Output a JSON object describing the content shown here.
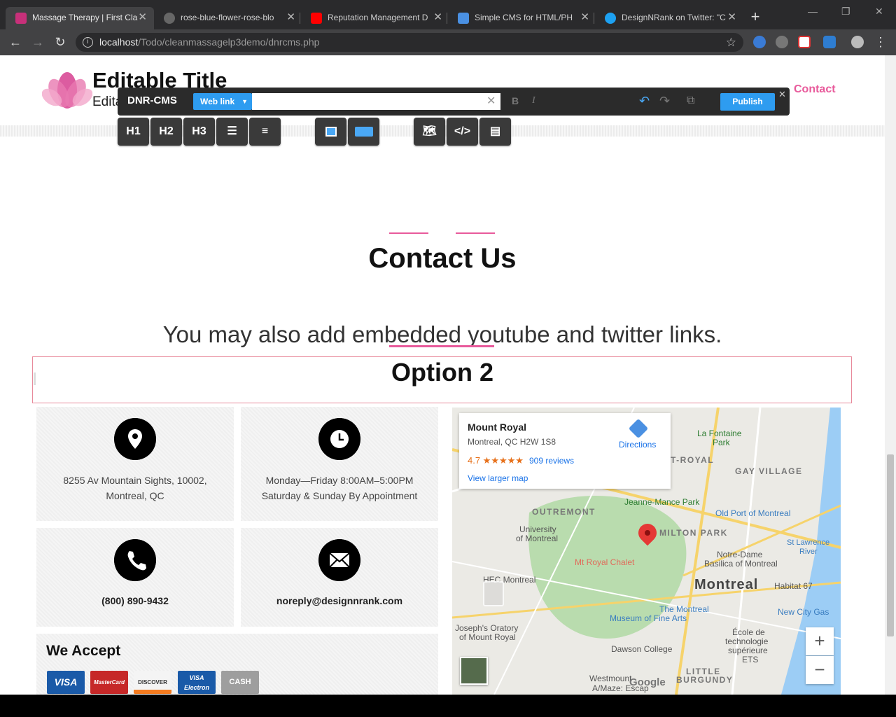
{
  "browser": {
    "tabs": [
      {
        "title": "Massage Therapy | First Cla",
        "color": "#c8307a"
      },
      {
        "title": "rose-blue-flower-rose-blo",
        "color": "#666666"
      },
      {
        "title": "Reputation Management D",
        "color": "#ff0000"
      },
      {
        "title": "Simple CMS for HTML/PH",
        "color": "#4a90e2"
      },
      {
        "title": "DesignNRank on Twitter: \"C",
        "color": "#1da1f2"
      }
    ],
    "url_host": "localhost",
    "url_path": "/Todo/cleanmassagelp3demo/dnrcms.php"
  },
  "site": {
    "title": "Editable Title",
    "subtitle": "Edita",
    "nav_contact": "Contact",
    "accent": "#e85a9b"
  },
  "cms": {
    "brand": "DNR-CMS",
    "link_type": "Web link",
    "link_value": "",
    "bold": "B",
    "italic": "I",
    "publish": "Publish",
    "tools": [
      "H1",
      "H2",
      "H3"
    ]
  },
  "content": {
    "heading": "Contact Us",
    "lead": "You may also add embedded youtube and twitter links.",
    "option_title": "Option 2"
  },
  "contact": {
    "address_line1": "8255 Av Mountain Sights, 10002,",
    "address_line2": "Montreal, QC",
    "hours_line1": "Monday—Friday 8:00AM–5:00PM",
    "hours_line2": "Saturday & Sunday By Appointment",
    "phone": "(800) 890-9432",
    "email": "noreply@designnrank.com",
    "accept_title": "We Accept",
    "payments": [
      {
        "label": "VISA",
        "color": "#1a5aa8"
      },
      {
        "label": "MasterCard",
        "color": "#c62828"
      },
      {
        "label": "DISCOVER",
        "color": "#f4f4f4"
      },
      {
        "label": "VISA Electron",
        "color": "#1a5aa8"
      },
      {
        "label": "CASH",
        "color": "#9e9e9e"
      }
    ]
  },
  "map": {
    "place": "Mount Royal",
    "address": "Montreal, QC H2W 1S8",
    "rating": "4.7 ★★★★★",
    "reviews": "909 reviews",
    "larger": "View larger map",
    "directions": "Directions",
    "labels": {
      "city": "Montreal",
      "milton": "MILTON PARK",
      "outremont": "OUTREMONT",
      "gay_village": "GAY VILLAGE",
      "royal": "T-ROYAL",
      "lafontaine": "La Fontaine",
      "lafontaine2": "Park",
      "jeanne": "Jeanne-Mance Park",
      "oldport": "Old Port of Montreal",
      "university": "University",
      "university2": "of Montreal",
      "chalet": "Mt Royal Chalet",
      "notre": "Notre-Dame",
      "basilica": "Basilica of Montreal",
      "hec": "HEC Montreal",
      "habitat": "Habitat 67",
      "museum1": "The Montreal",
      "museum2": "Museum of Fine Arts",
      "newcity": "New City Gas",
      "stlaw": "St Lawrence",
      "river": "River",
      "joseph1": "Joseph's Oratory",
      "joseph2": "of Mount Royal",
      "ecole1": "École de",
      "ecole2": "technologie",
      "ecole3": "supérieure",
      "ets": "ETS",
      "dawson": "Dawson College",
      "little": "LITTLE",
      "burgundy": "BURGUNDY",
      "westmount": "Westmount",
      "amaze": "A/Maze: Escap",
      "google": "Google"
    }
  }
}
